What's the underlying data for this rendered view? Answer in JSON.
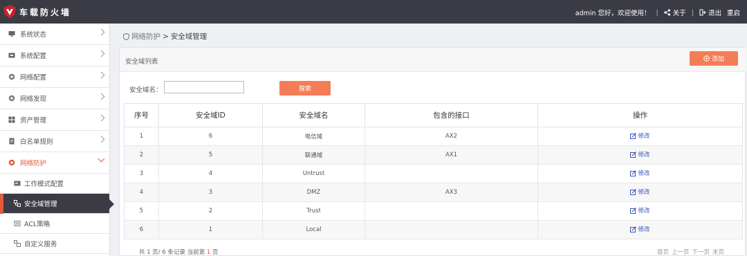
{
  "app": {
    "title": "车载防火墙"
  },
  "header": {
    "greeting": "admin 您好，欢迎使用！",
    "sep": "|",
    "about": "关于",
    "logout": "退出",
    "restart": "重启"
  },
  "sidebar": {
    "items": [
      {
        "label": "系统状态",
        "icon": "monitor-icon"
      },
      {
        "label": "系统配置",
        "icon": "settings-box-icon"
      },
      {
        "label": "网络配置",
        "icon": "globe-icon"
      },
      {
        "label": "网络发现",
        "icon": "globe-icon"
      },
      {
        "label": "资产管理",
        "icon": "grid-icon"
      },
      {
        "label": "白名单规则",
        "icon": "document-icon"
      },
      {
        "label": "网络防护",
        "icon": "globe-icon",
        "open": true
      }
    ],
    "sub_items": [
      {
        "label": "工作模式配置",
        "icon": "config-icon"
      },
      {
        "label": "安全域管理",
        "icon": "domain-icon",
        "active": true
      },
      {
        "label": "ACL策略",
        "icon": "policy-icon"
      },
      {
        "label": "自定义服务",
        "icon": "service-icon"
      }
    ]
  },
  "breadcrumb": {
    "parent": "网络防护",
    "sep": ">",
    "current": "安全域管理"
  },
  "panel": {
    "title": "安全域列表",
    "add_label": "添加"
  },
  "search": {
    "label": "安全域名：",
    "value": "",
    "button": "搜索"
  },
  "table": {
    "headers": [
      "序号",
      "安全域ID",
      "安全域名",
      "包含的接口",
      "操作"
    ],
    "edit_label": "修改",
    "rows": [
      {
        "no": "1",
        "id": "6",
        "name": "电信域",
        "iface": "AX2"
      },
      {
        "no": "2",
        "id": "5",
        "name": "联通域",
        "iface": "AX1"
      },
      {
        "no": "3",
        "id": "4",
        "name": "Untrust",
        "iface": ""
      },
      {
        "no": "4",
        "id": "3",
        "name": "DMZ",
        "iface": "AX3"
      },
      {
        "no": "5",
        "id": "2",
        "name": "Trust",
        "iface": ""
      },
      {
        "no": "6",
        "id": "1",
        "name": "Local",
        "iface": ""
      }
    ]
  },
  "footer": {
    "summary_a": "共 1 页/ 6 条记录 当前第",
    "current_page": "1",
    "summary_b": "页",
    "pager": [
      "首页",
      "上一页",
      "下一页",
      "末页"
    ]
  },
  "colors": {
    "accent": "#f47c57",
    "topbar": "#3a3b45",
    "active_red": "#e05a3b",
    "link": "#3a55b4"
  }
}
